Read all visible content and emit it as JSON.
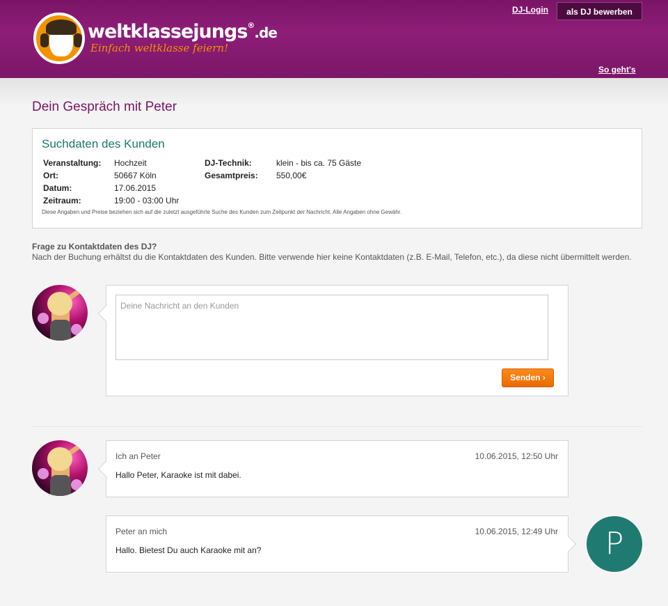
{
  "header": {
    "logo": {
      "title": "weltklassejungs",
      "registered": "®",
      "tld": ".de",
      "slogan": "Einfach weltklasse feiern!"
    },
    "login_link": "DJ-Login",
    "apply_button": "als DJ bewerben",
    "how_link": "So geht's"
  },
  "page_title": "Dein Gespräch mit Peter",
  "search_data": {
    "heading": "Suchdaten des Kunden",
    "left": [
      {
        "label": "Veranstaltung:",
        "value": "Hochzeit"
      },
      {
        "label": "Ort:",
        "value": "50667 Köln"
      },
      {
        "label": "Datum:",
        "value": "17.06.2015"
      },
      {
        "label": "Zeitraum:",
        "value": "19:00 - 03:00 Uhr"
      }
    ],
    "right": [
      {
        "label": "DJ-Technik:",
        "value": "klein - bis ca. 75 Gäste"
      },
      {
        "label": "Gesamtpreis:",
        "value": "550,00€"
      }
    ],
    "note": "Diese Angaben und Preise beziehen sich auf die zuletzt ausgeführte Suche des Kunden zum Zeitpunkt der Nachricht. Alle Angaben ohne Gewähr."
  },
  "contact_info": {
    "title": "Frage zu Kontaktdaten des DJ?",
    "text": "Nach der Buchung erhältst du die Kontaktdaten des Kunden. Bitte verwende hier keine Kontaktdaten (z.B. E-Mail, Telefon, etc.), da diese nicht übermittelt werden."
  },
  "compose": {
    "placeholder": "Deine Nachricht an den Kunden",
    "send_label": "Senden ›"
  },
  "messages": [
    {
      "from": "Ich an Peter",
      "time": "10.06.2015, 12:50 Uhr",
      "text": "Hallo Peter, Karaoke ist mit dabei."
    },
    {
      "from": "Peter an mich",
      "time": "10.06.2015, 12:49 Uhr",
      "text": "Hallo. Bietest Du auch Karaoke mit an?"
    }
  ],
  "peter_avatar_letter": "P",
  "colors": {
    "header": "#7a1466",
    "accent_orange": "#f39200",
    "heading_teal": "#1a7a6a",
    "peter_avatar": "#1f7b72"
  }
}
